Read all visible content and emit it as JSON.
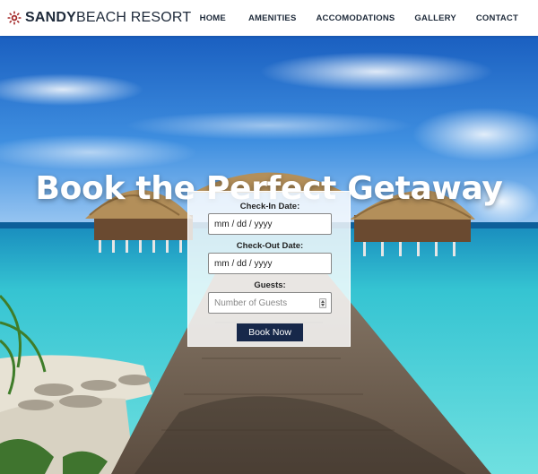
{
  "brand": {
    "name_bold": "SANDY",
    "name_light": "BEACH RESORT",
    "icon": "sun-logo-icon",
    "color": "#a42a2a"
  },
  "nav": {
    "items": [
      {
        "label": "HOME"
      },
      {
        "label": "AMENITIES"
      },
      {
        "label": "ACCOMODATIONS"
      },
      {
        "label": "GALLERY"
      },
      {
        "label": "CONTACT"
      }
    ]
  },
  "hero": {
    "headline": "Book the Perfect Getaway"
  },
  "booking": {
    "checkin_label": "Check-In Date:",
    "checkin_value": "mm / dd / yyyy",
    "checkout_label": "Check-Out Date:",
    "checkout_value": "mm / dd / yyyy",
    "guests_label": "Guests:",
    "guests_placeholder": "Number of Guests",
    "submit_label": "Book Now",
    "button_color": "#17284a"
  }
}
